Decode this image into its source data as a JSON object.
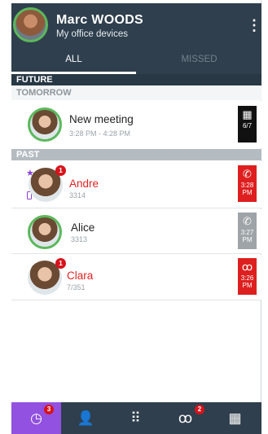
{
  "header": {
    "name": "Marc WOODS",
    "subtitle": "My office devices",
    "more_icon": "⋮"
  },
  "tabs": {
    "all": "ALL",
    "missed": "MISSED"
  },
  "sections": {
    "future": "FUTURE",
    "tomorrow": "TOMORROW",
    "past": "PAST"
  },
  "meeting": {
    "title": "New meeting",
    "time": "3:28 PM - 4:28 PM",
    "date": "6/7"
  },
  "calls": [
    {
      "name": "Andre",
      "number": "3314",
      "badge": "1",
      "time_top": "3:28",
      "time_bottom": "PM",
      "status": "missed"
    },
    {
      "name": "Alice",
      "number": "3313",
      "badge": "",
      "time_top": "3:27",
      "time_bottom": "PM",
      "status": "answered"
    },
    {
      "name": "Clara",
      "number": "7/351",
      "badge": "1",
      "time_top": "3:26",
      "time_bottom": "PM",
      "status": "voicemail"
    }
  ],
  "nav": {
    "history_badge": "3",
    "voicemail_badge": "2"
  },
  "colors": {
    "header_bg": "#2f3f4d",
    "missed_red": "#de1f1f",
    "active_purple": "#9251e0",
    "presence_green": "#5cb85c"
  }
}
